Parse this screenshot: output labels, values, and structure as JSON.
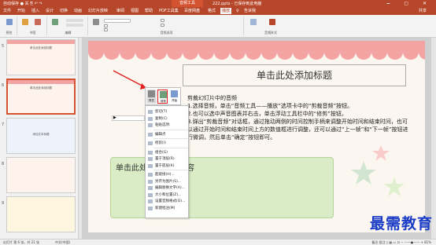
{
  "titlebar": {
    "quick_access": "自动保存 ● 关 ⎘ ↶ ↷",
    "context_tab": "音频工具",
    "filename": "222.pptx - 已保存到此电脑",
    "win_buttons": "🗕 ▢ ✕"
  },
  "tabs": [
    "文件",
    "开始",
    "插入",
    "设计",
    "切换",
    "动画",
    "幻灯片放映",
    "审阅",
    "视图",
    "帮助",
    "PDF工具集",
    "百度网盘",
    "格式",
    "播放",
    "♀",
    "告诉我",
    "共享"
  ],
  "active_tab_index": 13,
  "ribbon": {
    "groups": [
      "预览",
      "书签",
      "编辑",
      "音频选项",
      "音频样式"
    ],
    "buttons": [
      "播放",
      "添加书签",
      "删除书签",
      "剪裁音频",
      "渐强",
      "渐弱",
      "音量",
      "开始",
      "跨幻灯片播放",
      "循环播放，直到停止",
      "放映时隐藏",
      "播完返回开头",
      "无样式",
      "在后台播放"
    ]
  },
  "thumbnails": [
    {
      "num": "5",
      "title": "单击此处添加标题"
    },
    {
      "num": "6",
      "title": "单击此处添加标题"
    },
    {
      "num": "7",
      "title": "添加文本标题"
    },
    {
      "num": "8",
      "title": ""
    },
    {
      "num": "9",
      "title": ""
    }
  ],
  "slide": {
    "title": "单击此处添加标题",
    "body_lines": [
      "剪裁幻灯片中的音频",
      "1.选择音频，单击“音频工具——播放”选项卡中的“剪裁音频”按钮。",
      "2.也可以选中声音图表并右击，单击浮动工具栏中的“修剪”按钮。",
      "3.弹出“剪裁音频”对话框，通过拖动两侧的时间控制手柄来调整开始时间和结束时间，也可以通过开始时间和结束时间上方的数值框进行调整，还可以通过“上一帧”和“下一帧”按钮进行微调，然后单击“确定”按钮即可。"
    ],
    "green_box_text": "单击此处添加文本内容"
  },
  "mini_toolbar": {
    "buttons": [
      "样式",
      "修剪",
      "开始"
    ]
  },
  "context_menu": {
    "items": [
      "剪切(T)",
      "复制(C)",
      "粘贴选项:",
      "",
      "编辑点",
      "",
      "修剪(I)",
      "",
      "组合(G)",
      "置于顶层(R)",
      "置于底层(K)",
      "",
      "超链接(H)...",
      "另存为图片(S)...",
      "编辑替换文字(A)...",
      "大小和位置(Z)...",
      "设置音频格式(O)...",
      "新建批注(M)"
    ]
  },
  "statusbar": {
    "left": "幻灯片 第 6 张，共 21 张",
    "lang": "中文(中国)",
    "right": "备注  批注   ▯ ▦ ▭ ⊟   − ——●—— +  81%"
  },
  "watermark": "最需教育",
  "colors": {
    "accent": "#b7472a",
    "thumb_strip": "#f4a3a3",
    "scallop": "#f4a3a3",
    "green_box": "#d9ecc6",
    "watermark": "#1a3cc6"
  }
}
